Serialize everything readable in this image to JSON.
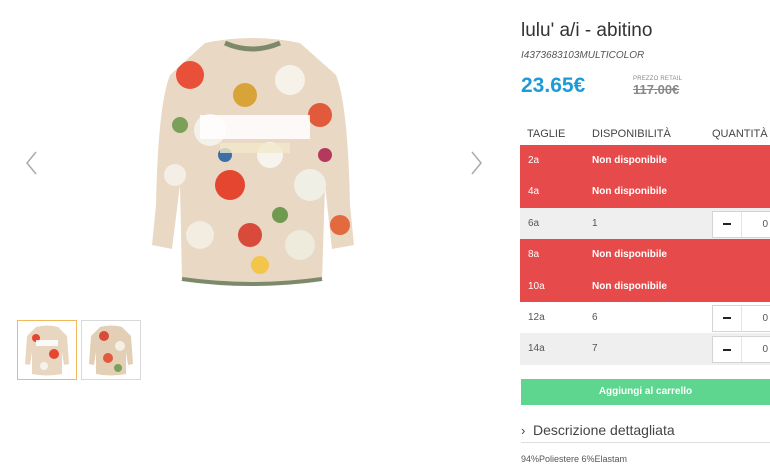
{
  "product": {
    "title": "lulu' a/i - abitino",
    "sku": "I4373683103MULTICOLOR",
    "price": "23.65€",
    "retail_label": "PREZZO RETAIL",
    "retail_price": "117.00€"
  },
  "gallery": {
    "main_icon": "sweater-product-photo",
    "thumbnails": [
      {
        "icon": "sweater-front-thumbnail",
        "active": true
      },
      {
        "icon": "sweater-back-thumbnail",
        "active": false
      }
    ],
    "prev_icon": "chevron-left-icon",
    "next_icon": "chevron-right-icon"
  },
  "table": {
    "headers": {
      "size": "TAGLIE",
      "availability": "DISPONIBILITÀ",
      "quantity": "QUANTITÀ"
    },
    "rows": [
      {
        "size": "2a",
        "availability": "Non disponibile",
        "available": false
      },
      {
        "size": "4a",
        "availability": "Non disponibile",
        "available": false
      },
      {
        "size": "6a",
        "availability": "1",
        "available": true,
        "qty": "0"
      },
      {
        "size": "8a",
        "availability": "Non disponibile",
        "available": false
      },
      {
        "size": "10a",
        "availability": "Non disponibile",
        "available": false
      },
      {
        "size": "12a",
        "availability": "6",
        "available": true,
        "qty": "0"
      },
      {
        "size": "14a",
        "availability": "7",
        "available": true,
        "qty": "0"
      }
    ]
  },
  "cart": {
    "add_label": "Aggiungi al carrello"
  },
  "description": {
    "toggle_label": "Descrizione dettagliata",
    "composition": "94%Poliestere 6%Elastam"
  },
  "colors": {
    "price": "#1f9ad6",
    "unavailable": "#e74a4a",
    "add_button": "#5ed690",
    "thumb_active": "#f0b95b"
  }
}
